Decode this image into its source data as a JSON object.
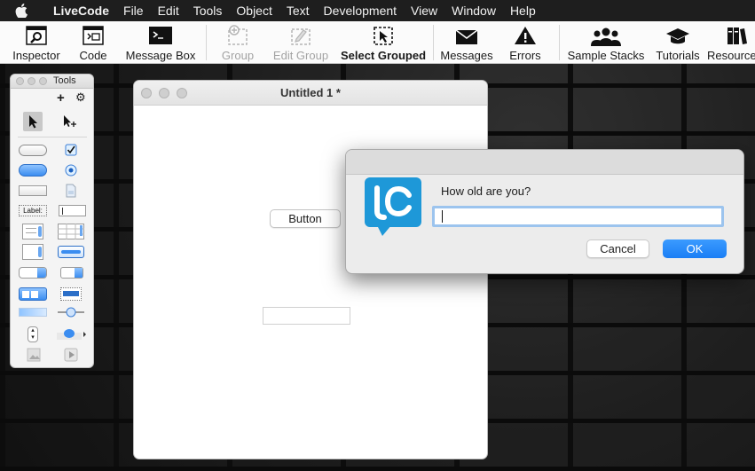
{
  "menubar": {
    "items": [
      {
        "label": "LiveCode",
        "icon": "apple-icon"
      },
      {
        "label": "File"
      },
      {
        "label": "Edit"
      },
      {
        "label": "Tools"
      },
      {
        "label": "Object"
      },
      {
        "label": "Text"
      },
      {
        "label": "Development"
      },
      {
        "label": "View"
      },
      {
        "label": "Window"
      },
      {
        "label": "Help"
      }
    ]
  },
  "toolbar": {
    "items": [
      {
        "label": "Inspector",
        "icon": "inspector-icon",
        "enabled": true
      },
      {
        "label": "Code",
        "icon": "code-icon",
        "enabled": true
      },
      {
        "label": "Message Box",
        "icon": "message-box-icon",
        "enabled": true
      },
      {
        "label": "Group",
        "icon": "group-icon",
        "enabled": false
      },
      {
        "label": "Edit Group",
        "icon": "edit-group-icon",
        "enabled": false
      },
      {
        "label": "Select Grouped",
        "icon": "select-grouped-icon",
        "enabled": true
      },
      {
        "label": "Messages",
        "icon": "envelope-icon",
        "enabled": true
      },
      {
        "label": "Errors",
        "icon": "warning-icon",
        "enabled": true
      },
      {
        "label": "Sample Stacks",
        "icon": "people-icon",
        "enabled": true
      },
      {
        "label": "Tutorials",
        "icon": "graduation-cap-icon",
        "enabled": true
      },
      {
        "label": "Resources",
        "icon": "books-icon",
        "enabled": true
      }
    ]
  },
  "palette": {
    "title": "Tools",
    "add_label": "+",
    "tools": [
      "pointer-tool-icon",
      "run-tool-icon",
      "button-tool-icon",
      "checkbox-tool-icon",
      "default-button-tool-icon",
      "radio-tool-icon",
      "rectangle-button-tool-icon",
      "file-tool-icon",
      "label-field-tool-icon",
      "text-field-tool-icon",
      "scrolling-list-tool-icon",
      "table-tool-icon",
      "scroll-field-tool-icon",
      "progress-tool-icon",
      "option-menu-tool-icon",
      "combo-box-tool-icon",
      "popup-menu-tool-icon",
      "menu-tool-icon",
      "horizontal-scrollbar-tool-icon",
      "slider-tool-icon",
      "stepper-tool-icon",
      "tab-panel-tool-icon",
      "image-tool-icon",
      "player-tool-icon"
    ],
    "label_field_text": "Label:"
  },
  "document": {
    "title": "Untitled 1 *",
    "button_label": "Button",
    "field_value": ""
  },
  "dialog": {
    "prompt": "How old are you?",
    "answer_value": "",
    "cancel_label": "Cancel",
    "ok_label": "OK",
    "logo_text": "lc",
    "colors": {
      "logo": "#1e98d8",
      "ok": "#1a7ef5",
      "focus_ring": "#9cc4ee"
    }
  }
}
